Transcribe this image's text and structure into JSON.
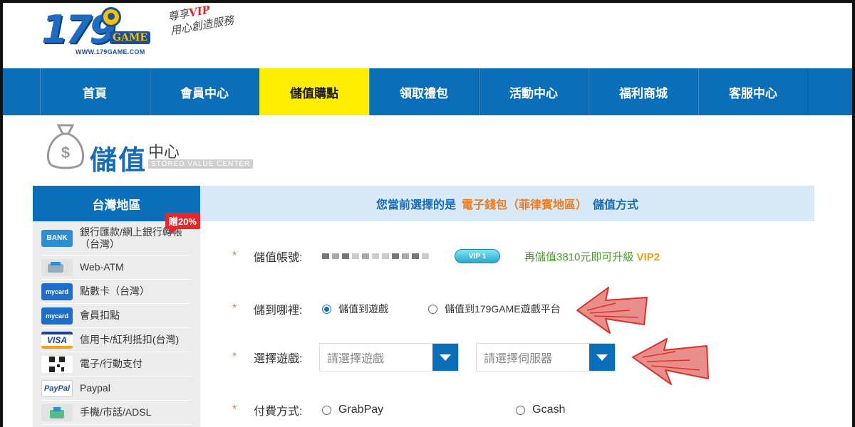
{
  "header": {
    "logo_number": "179",
    "logo_game": "GAME",
    "logo_url": "WWW.179GAME.COM",
    "slogan_pre": "尊享",
    "slogan_vip": "VIP",
    "slogan_post": "用心創造服務"
  },
  "nav": {
    "items": [
      "首頁",
      "會員中心",
      "儲值購點",
      "領取禮包",
      "活動中心",
      "福利商城",
      "客服中心"
    ],
    "active_index": 2
  },
  "title": {
    "main": "儲值",
    "sub": "中心",
    "english": "STORED VALUE CENTER"
  },
  "sidebar": {
    "heading": "台灣地區",
    "gift_badge": "贈20%",
    "items": [
      {
        "icon": "bank-icon",
        "icon_text": "BANK",
        "label": "銀行匯款/網上銀行轉帳（台灣）"
      },
      {
        "icon": "web-atm-icon",
        "icon_text": "",
        "label": "Web-ATM"
      },
      {
        "icon": "mycard-icon",
        "icon_text": "mycard",
        "label": "點數卡（台灣）"
      },
      {
        "icon": "mycard-member-icon",
        "icon_text": "mycard",
        "label": "會員扣點"
      },
      {
        "icon": "visa-icon",
        "icon_text": "VISA",
        "label": "信用卡/紅利抵扣(台灣)"
      },
      {
        "icon": "qr-code-icon",
        "icon_text": "",
        "label": "電子/行動支付"
      },
      {
        "icon": "paypal-icon",
        "icon_text": "PayPal",
        "label": "Paypal"
      },
      {
        "icon": "phone-icon",
        "icon_text": "",
        "label": "手機/市話/ADSL"
      }
    ]
  },
  "main": {
    "banner_pre": "您當前選擇的是",
    "banner_highlight": "電子錢包（菲律賓地區）",
    "banner_post": "儲值方式",
    "account_label": "儲值帳號:",
    "vip_badge": "VIP 1",
    "upgrade_pre": "再儲值3810元即可升級",
    "upgrade_level": "VIP2",
    "target_label": "儲到哪裡:",
    "target_options": [
      "儲值到遊戲",
      "儲值到179GAME遊戲平台"
    ],
    "target_selected": 0,
    "game_label": "選擇遊戲:",
    "game_placeholder": "請選擇遊戲",
    "server_placeholder": "請選擇伺服器",
    "pay_label": "付費方式:",
    "pay_options": [
      "GrabPay",
      "Gcash"
    ]
  },
  "colors": {
    "brand_blue": "#0a6fb8",
    "active_nav": "#ffee00",
    "highlight_orange": "#f07a1c",
    "annotation_red": "#d9322b"
  }
}
